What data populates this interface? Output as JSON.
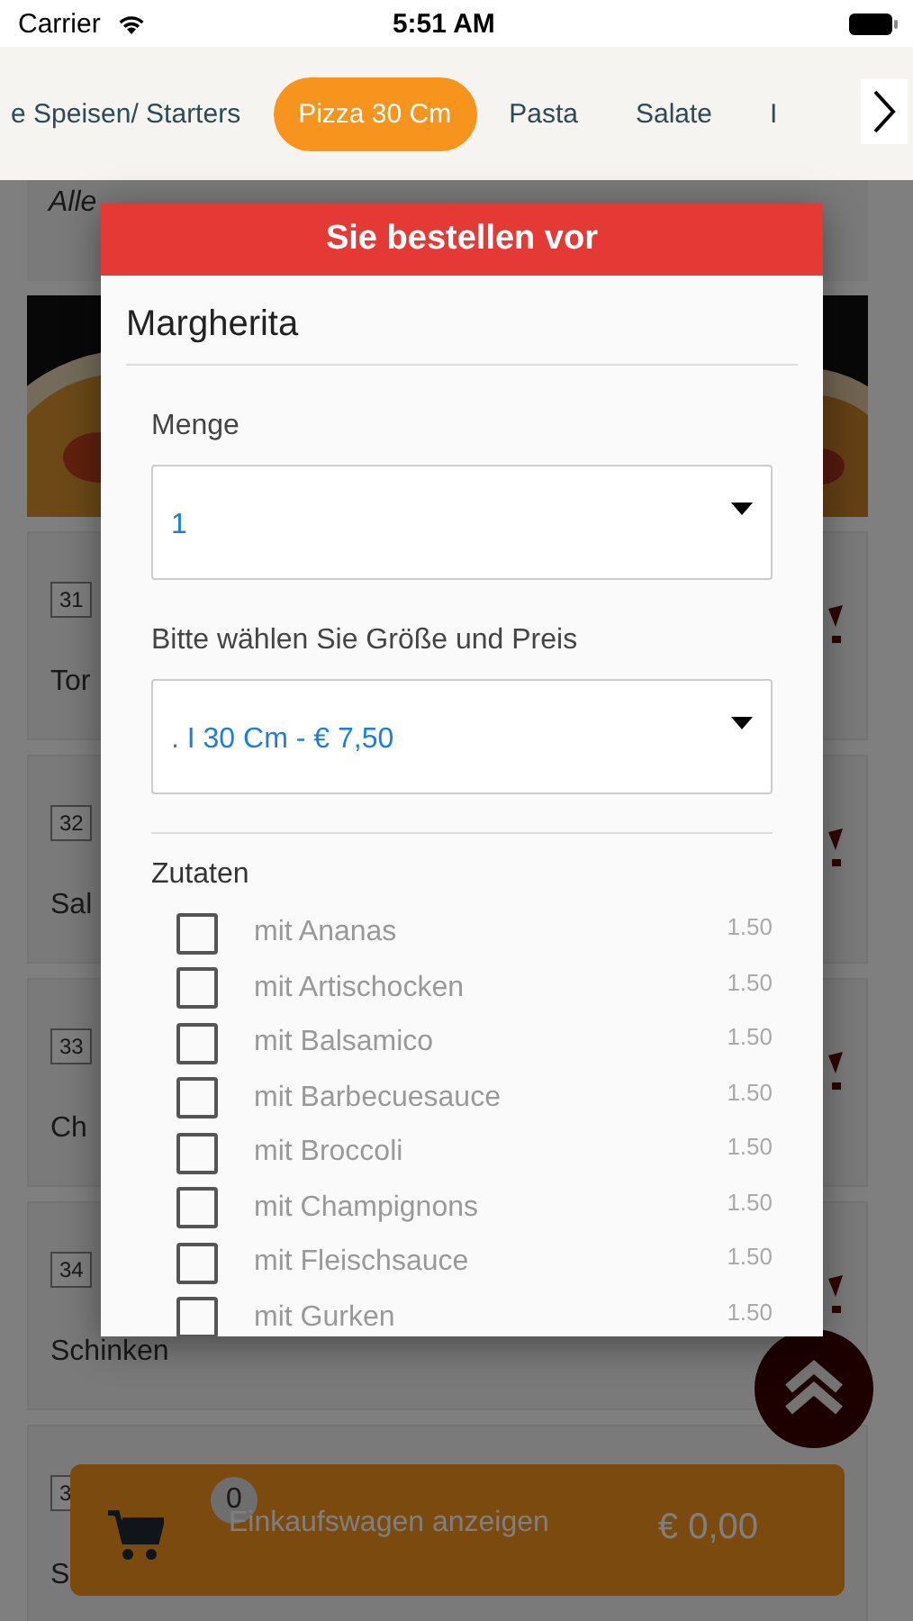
{
  "status_bar": {
    "carrier": "Carrier",
    "time": "5:51 AM"
  },
  "tabs": [
    {
      "label": "e Speisen/ Starters",
      "selected": false
    },
    {
      "label": "Pizza 30 Cm",
      "selected": true
    },
    {
      "label": "Pasta",
      "selected": false
    },
    {
      "label": "Salate",
      "selected": false
    },
    {
      "label": "I",
      "selected": false
    }
  ],
  "menu": {
    "note": "Alle",
    "items": [
      {
        "number": "31",
        "name": "Tor"
      },
      {
        "number": "32",
        "name": "Sal"
      },
      {
        "number": "33",
        "name": "Ch"
      },
      {
        "number": "34",
        "name": "Schinken"
      },
      {
        "number": "3",
        "name": "S"
      }
    ]
  },
  "dialog": {
    "title": "Sie bestellen vor",
    "product": "Margherita",
    "quantity_label": "Menge",
    "quantity": "1",
    "size_label": "Bitte wählen Sie Größe und Preis",
    "size": ". I 30 Cm - € 7,50",
    "extras_label": "Zutaten",
    "extras": [
      {
        "name": "mit Ananas",
        "price": "1.50",
        "checked": false
      },
      {
        "name": "mit Artischocken",
        "price": "1.50",
        "checked": false
      },
      {
        "name": "mit Balsamico",
        "price": "1.50",
        "checked": false
      },
      {
        "name": "mit Barbecuesauce",
        "price": "1.50",
        "checked": false
      },
      {
        "name": "mit Broccoli",
        "price": "1.50",
        "checked": false
      },
      {
        "name": "mit Champignons",
        "price": "1.50",
        "checked": false
      },
      {
        "name": "mit Fleischsauce",
        "price": "1.50",
        "checked": false
      },
      {
        "name": "mit Gurken",
        "price": "1.50",
        "checked": false
      }
    ]
  },
  "cart": {
    "count": "0",
    "label": "Einkaufswagen anzeigen",
    "total": "€ 0,00"
  }
}
